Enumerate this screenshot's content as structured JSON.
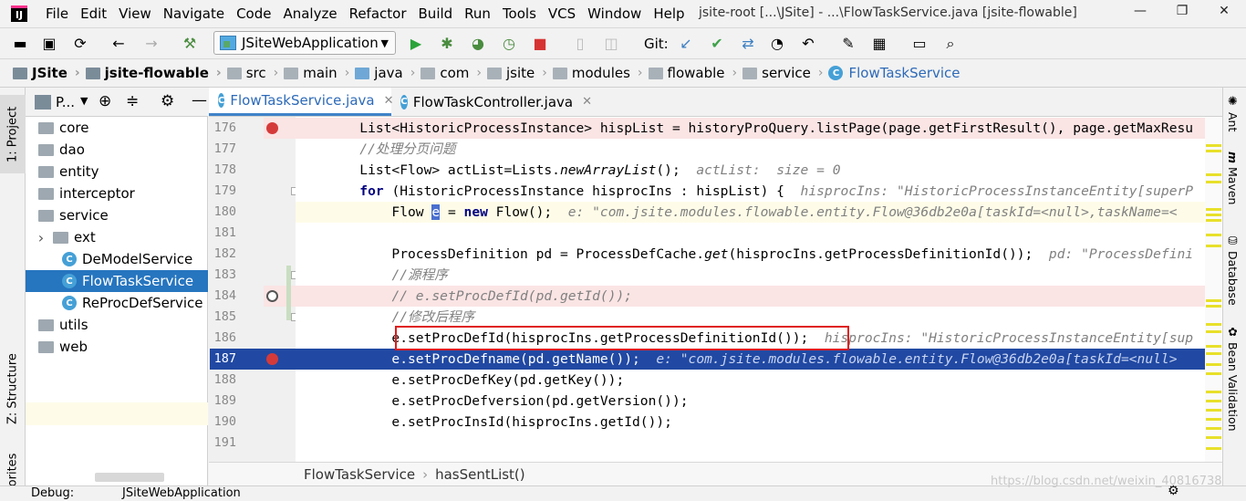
{
  "menu": [
    "File",
    "Edit",
    "View",
    "Navigate",
    "Code",
    "Analyze",
    "Refactor",
    "Build",
    "Run",
    "Tools",
    "VCS",
    "Window",
    "Help"
  ],
  "window_title": "jsite-root [...\\JSite] - ...\\FlowTaskService.java [jsite-flowable]",
  "toolbar": {
    "run_config": "JSiteWebApplication",
    "git_label": "Git:"
  },
  "breadcrumb": [
    "JSite",
    "jsite-flowable",
    "src",
    "main",
    "java",
    "com",
    "jsite",
    "modules",
    "flowable",
    "service",
    "FlowTaskService"
  ],
  "left_tabs": {
    "project": "1: Project",
    "structure": "Z: Structure",
    "favorites": "avorites"
  },
  "project_panel": {
    "title": "P...",
    "tree": [
      "core",
      "dao",
      "entity",
      "interceptor",
      "service",
      "ext",
      "DeModelService",
      "FlowTaskService",
      "ReProcDefService",
      "utils",
      "web"
    ]
  },
  "editor_tabs": [
    "FlowTaskService.java",
    "FlowTaskController.java"
  ],
  "code_lines": [
    {
      "num": "176",
      "parts": [
        {
          "t": "        List<HistoricProcessInstance> hispList = historyProQuery.listPage(page.getFirstResult(), page.getMaxResu"
        }
      ]
    },
    {
      "num": "177",
      "parts": [
        {
          "t": "        ",
          "c": ""
        },
        {
          "t": "//处理分页问题",
          "c": "cm"
        }
      ]
    },
    {
      "num": "178",
      "parts": [
        {
          "t": "        List<Flow> actList=Lists."
        },
        {
          "t": "newArrayList",
          "c": "it"
        },
        {
          "t": "();  "
        },
        {
          "t": "actList:  size = 0",
          "c": "dbg"
        }
      ]
    },
    {
      "num": "179",
      "parts": [
        {
          "t": "        "
        },
        {
          "t": "for",
          "c": "kw"
        },
        {
          "t": " (HistoricProcessInstance hisprocIns : hispList) {  "
        },
        {
          "t": "hisprocIns: \"HistoricProcessInstanceEntity[superP",
          "c": "dbg"
        }
      ]
    },
    {
      "num": "180",
      "parts": [
        {
          "t": "            Flow "
        },
        {
          "t": "e",
          "c": "hl-var"
        },
        {
          "t": " = "
        },
        {
          "t": "new",
          "c": "kw"
        },
        {
          "t": " Flow();  "
        },
        {
          "t": "e: \"com.jsite.modules.flowable.entity.Flow@36db2e0a[taskId=<null>,taskName=<",
          "c": "dbg"
        }
      ]
    },
    {
      "num": "181",
      "parts": [
        {
          "t": ""
        }
      ]
    },
    {
      "num": "182",
      "parts": [
        {
          "t": "            ProcessDefinition pd = ProcessDefCache."
        },
        {
          "t": "get",
          "c": "it"
        },
        {
          "t": "(hisprocIns.getProcessDefinitionId());  "
        },
        {
          "t": "pd: \"ProcessDefini",
          "c": "dbg"
        }
      ]
    },
    {
      "num": "183",
      "parts": [
        {
          "t": "            "
        },
        {
          "t": "//源程序",
          "c": "cm"
        }
      ]
    },
    {
      "num": "184",
      "parts": [
        {
          "t": "            "
        },
        {
          "t": "// e.setProcDefId(pd.getId());",
          "c": "cm"
        }
      ]
    },
    {
      "num": "185",
      "parts": [
        {
          "t": "            "
        },
        {
          "t": "//修改后程序",
          "c": "cm"
        }
      ]
    },
    {
      "num": "186",
      "parts": [
        {
          "t": "            e.setProcDefId(hisprocIns.getProcessDefinitionId());  "
        },
        {
          "t": "hisprocIns: \"HistoricProcessInstanceEntity[sup",
          "c": "dbg"
        }
      ]
    },
    {
      "num": "187",
      "parts": [
        {
          "t": "            e.setProcDefname(pd.getName());  "
        },
        {
          "t": "e: \"com.jsite.modules.flowable.entity.Flow@36db2e0a[taskId=<null>",
          "c": "dbg"
        }
      ]
    },
    {
      "num": "188",
      "parts": [
        {
          "t": "            e.setProcDefKey(pd.getKey());"
        }
      ]
    },
    {
      "num": "189",
      "parts": [
        {
          "t": "            e.setProcDefversion(pd.getVersion());"
        }
      ]
    },
    {
      "num": "190",
      "parts": [
        {
          "t": "            e.setProcInsId(hisprocIns.getId());"
        }
      ]
    },
    {
      "num": "191",
      "parts": [
        {
          "t": ""
        }
      ]
    }
  ],
  "editor_breadcrumb": [
    "FlowTaskService",
    "hasSentList()"
  ],
  "right_tabs": [
    "Ant",
    "Maven",
    "Database",
    "Bean Validation"
  ],
  "bottom": {
    "debug_label": "Debug:",
    "debug_config": "JSiteWebApplication"
  },
  "watermark": "https://blog.csdn.net/weixin_40816738"
}
